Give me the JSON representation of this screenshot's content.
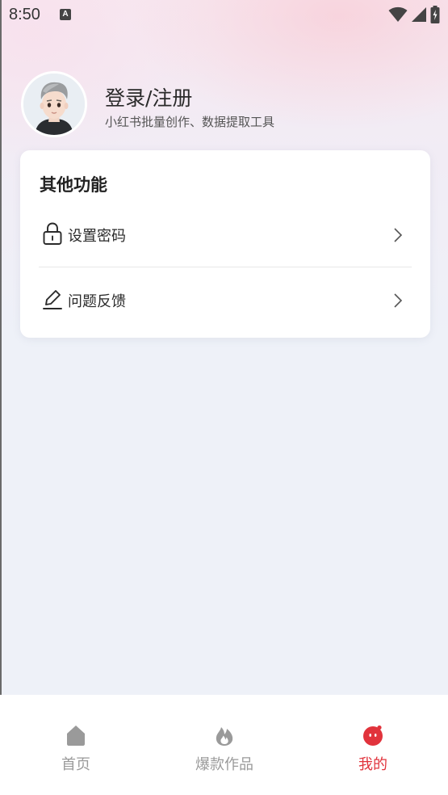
{
  "status_bar": {
    "time": "8:50",
    "notification_icon": "a-badge-icon",
    "wifi_icon": "wifi-icon",
    "signal_icon": "signal-icon",
    "battery_icon": "battery-charging-icon"
  },
  "profile": {
    "avatar_icon": "user-avatar",
    "title": "登录/注册",
    "subtitle": "小红书批量创作、数据提取工具"
  },
  "card": {
    "title": "其他功能",
    "items": [
      {
        "label": "设置密码",
        "icon": "lock-icon"
      },
      {
        "label": "问题反馈",
        "icon": "edit-icon"
      }
    ]
  },
  "bottom_nav": {
    "items": [
      {
        "label": "首页",
        "icon": "home-icon",
        "active": false
      },
      {
        "label": "爆款作品",
        "icon": "flame-icon",
        "active": false
      },
      {
        "label": "我的",
        "icon": "profile-face-icon",
        "active": true
      }
    ]
  },
  "colors": {
    "accent": "#e1333c",
    "inactive": "#9a9a9a",
    "background": "#eef1f8"
  }
}
